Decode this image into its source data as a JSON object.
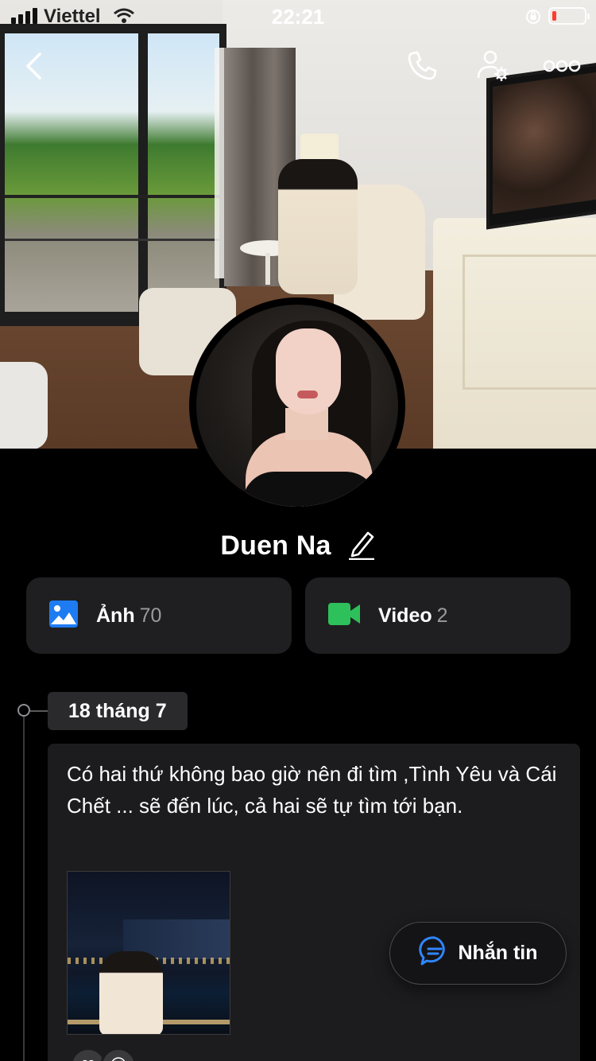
{
  "status_bar": {
    "carrier": "Viettel",
    "time": "22:21"
  },
  "profile": {
    "name": "Duen Na"
  },
  "media": {
    "photos": {
      "label": "Ảnh",
      "count": "70"
    },
    "videos": {
      "label": "Video",
      "count": "2"
    }
  },
  "timeline": {
    "date": "18 tháng 7",
    "post_text": "Có hai thứ không bao giờ nên đi tìm ,Tình Yêu và Cái Chết ... sẽ đến lúc, cả hai sẽ tự tìm tới bạn."
  },
  "actions": {
    "message_label": "Nhắn tin"
  },
  "icons": {
    "back": "chevron-left-icon",
    "call": "phone-icon",
    "settings": "user-settings-icon",
    "more": "more-icon",
    "edit": "pencil-icon",
    "photos": "image-icon",
    "videos": "video-camera-icon",
    "message": "chat-bubble-icon"
  },
  "colors": {
    "photo_icon": "#1e7cf2",
    "video_icon": "#2ec05b",
    "message_icon": "#2f86ff",
    "battery_low": "#ff3b30"
  }
}
